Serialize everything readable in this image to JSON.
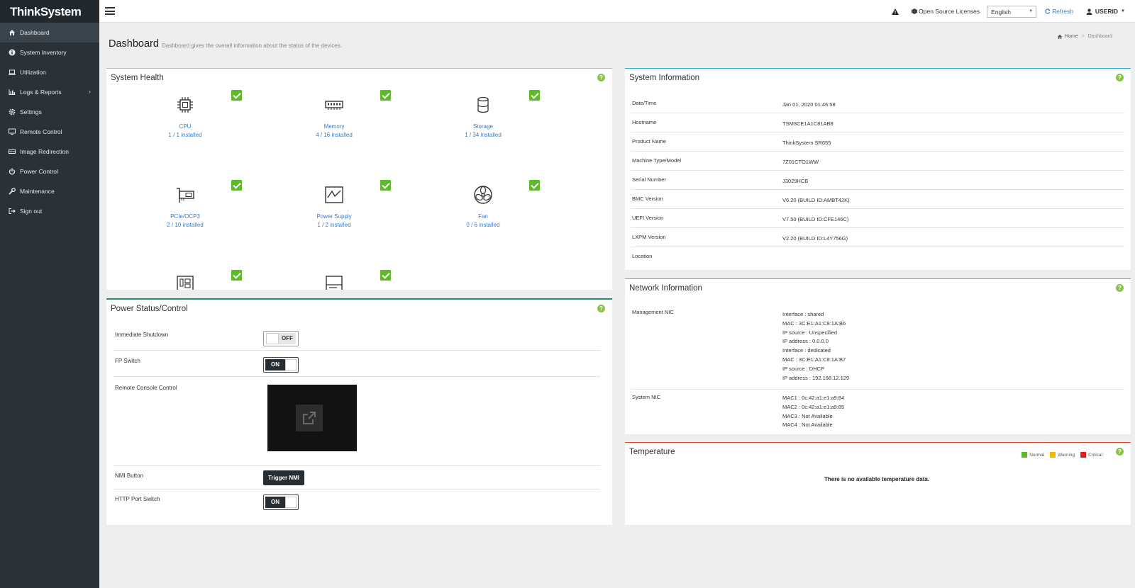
{
  "app": {
    "brand": "ThinkSystem"
  },
  "sidebar": {
    "items": [
      {
        "label": "Dashboard",
        "icon": "home-icon",
        "active": true
      },
      {
        "label": "System Inventory",
        "icon": "info-icon"
      },
      {
        "label": "Utilization",
        "icon": "laptop-icon"
      },
      {
        "label": "Logs & Reports",
        "icon": "bar-chart-icon"
      },
      {
        "label": "Settings",
        "icon": "gear-icon"
      },
      {
        "label": "Remote Control",
        "icon": "monitor-icon"
      },
      {
        "label": "Image Redirection",
        "icon": "drive-icon"
      },
      {
        "label": "Power Control",
        "icon": "power-icon"
      },
      {
        "label": "Maintenance",
        "icon": "wrench-icon"
      },
      {
        "label": "Sign out",
        "icon": "sign-out-icon"
      }
    ]
  },
  "topbar": {
    "open_source": "Open Source Licenses",
    "language": "English",
    "refresh": "Refresh",
    "user": "USERID"
  },
  "page": {
    "title": "Dashboard",
    "subtitle": "Dashboard gives the overall information about the status of the devices.",
    "breadcrumb_home": "Home",
    "breadcrumb_current": "Dashboard"
  },
  "health": {
    "title": "System Health",
    "items": [
      {
        "name": "CPU",
        "count": "1 / 1 installed",
        "icon": "cpu-icon",
        "status": "ok"
      },
      {
        "name": "Memory",
        "count": "4 / 16 installed",
        "icon": "memory-icon",
        "status": "ok"
      },
      {
        "name": "Storage",
        "count": "1 / 34 installed",
        "icon": "storage-icon",
        "status": "ok"
      },
      {
        "name": "PCIe/OCP3",
        "count": "2 / 10 installed",
        "icon": "pcie-icon",
        "status": "ok"
      },
      {
        "name": "Power Supply",
        "count": "1 / 2 installed",
        "icon": "power-supply-icon",
        "status": "ok"
      },
      {
        "name": "Fan",
        "count": "0 / 6 installed",
        "icon": "fan-icon",
        "status": "ok"
      },
      {
        "icon": "board-icon",
        "status": "ok"
      },
      {
        "icon": "drive-bay-icon",
        "status": "ok"
      }
    ]
  },
  "power": {
    "title": "Power Status/Control",
    "rows": [
      {
        "label": "Immediate Shutdown",
        "toggle": "OFF"
      },
      {
        "label": "FP Switch",
        "toggle": "ON"
      },
      {
        "label": "Remote Console Control"
      },
      {
        "label": "NMI Button",
        "button": "Trigger NMI"
      },
      {
        "label": "HTTP Port Switch",
        "toggle": "ON"
      }
    ]
  },
  "sysinfo": {
    "title": "System Information",
    "rows": [
      {
        "label": "Date/Time",
        "value": "Jan 01, 2020 01:46:58"
      },
      {
        "label": "Hostname",
        "value": "TSM3CE1A1C81AB8"
      },
      {
        "label": "Product Name",
        "value": "ThinkSystem SR655"
      },
      {
        "label": "Machine Type/Model",
        "value": "7Z01CTO1WW"
      },
      {
        "label": "Serial Number",
        "value": "J3029HCB"
      },
      {
        "label": "BMC Version",
        "value": "V6.20 (BUILD ID:AMBT42K)"
      },
      {
        "label": "UEFI Version",
        "value": "V7.50 (BUILD ID:CFE146C)"
      },
      {
        "label": "LXPM Version",
        "value": "V2.20 (BUILD ID:L4Y756G)"
      },
      {
        "label": "Location",
        "value": ""
      }
    ]
  },
  "network": {
    "title": "Network Information",
    "management_label": "Management NIC",
    "management_lines": [
      "Interface : shared",
      "MAC : 3C:E1:A1:C8:1A:B6",
      "IP source : Unspecified",
      "IP address : 0.0.0.0",
      "Interface : dedicated",
      "MAC : 3C:E1:A1:C8:1A:B7",
      "IP source : DHCP",
      "IP address : 192.168.12.129"
    ],
    "system_label": "System NIC",
    "system_lines": [
      "MAC1 : 0c:42:a1:e1:a9:84",
      "MAC2 : 0c:42:a1:e1:a9:85",
      "MAC3 : Not Available",
      "MAC4 : Not Available"
    ]
  },
  "temperature": {
    "title": "Temperature",
    "legend": [
      {
        "label": "Normal",
        "color": "#5dbb2a"
      },
      {
        "label": "Warning",
        "color": "#f5b800"
      },
      {
        "label": "Critical",
        "color": "#e02020"
      }
    ],
    "empty_message": "There is no available temperature data."
  },
  "colors": {
    "accent": "#3b7bbf",
    "ok": "#5dbb2a",
    "sysinfo_border": "#29a8d8",
    "network_border": "#e88a1a",
    "temperature_border": "#e0442a",
    "power_border": "#2e8b6e"
  }
}
